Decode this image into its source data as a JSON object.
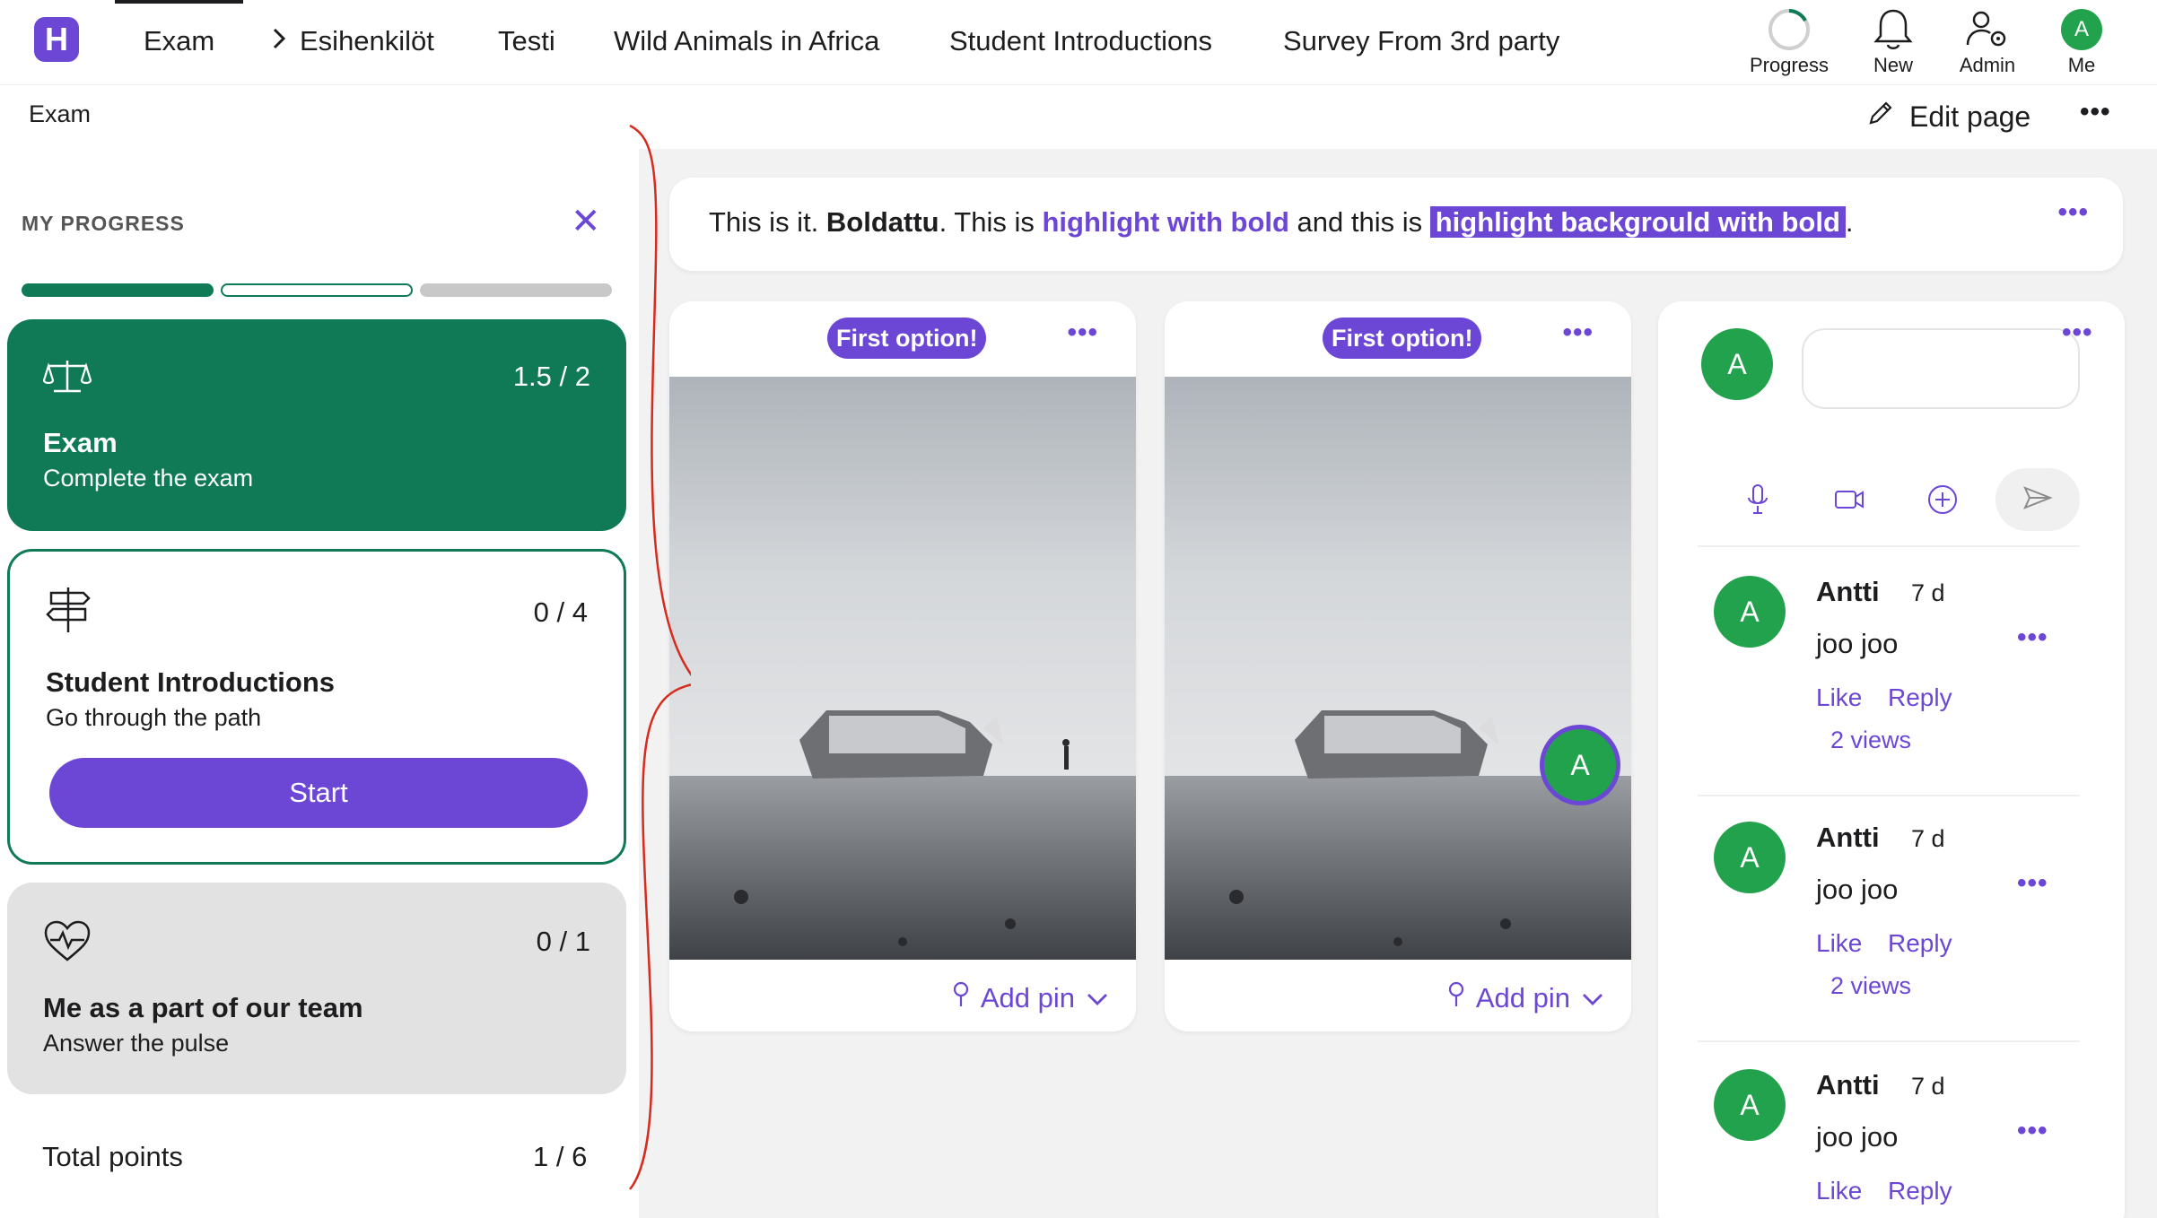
{
  "nav": {
    "logo": "H",
    "tabs": [
      {
        "label": "Exam",
        "active": true
      },
      {
        "label": "Esihenkilöt",
        "chevron": true
      },
      {
        "label": "Testi"
      },
      {
        "label": "Wild Animals in Africa"
      },
      {
        "label": "Student Introductions"
      },
      {
        "label": "Survey From 3rd party"
      }
    ],
    "right": [
      {
        "label": "Progress",
        "icon": "progress-ring-icon"
      },
      {
        "label": "New",
        "icon": "bell-icon"
      },
      {
        "label": "Admin",
        "icon": "user-gear-icon"
      },
      {
        "label": "Me",
        "icon": "avatar",
        "initial": "A"
      }
    ]
  },
  "breadcrumb": "Exam",
  "toolbar": {
    "edit_label": "Edit page"
  },
  "sidebar": {
    "heading": "MY PROGRESS",
    "cards": [
      {
        "title": "Exam",
        "subtitle": "Complete the exam",
        "score": "1.5 / 2",
        "icon": "scales-icon",
        "state": "completed"
      },
      {
        "title": "Student Introductions",
        "subtitle": "Go through the path",
        "score": "0 / 4",
        "icon": "signpost-icon",
        "state": "current",
        "button": "Start"
      },
      {
        "title": "Me as a part of our team",
        "subtitle": "Answer the pulse",
        "score": "0 / 1",
        "icon": "heart-pulse-icon",
        "state": "locked"
      }
    ],
    "total_label": "Total points",
    "total_value": "1 / 6"
  },
  "text_block": {
    "part1": "This is it. ",
    "bold": "Boldattu",
    "part2": ". This is ",
    "highlight_bold": "highlight with bold",
    "part3": " and this is ",
    "highlight_bg_bold": "highlight backgrould with bold",
    "part4": "."
  },
  "image_cards": [
    {
      "option_label": "First option!",
      "add_pin_label": "Add pin"
    },
    {
      "option_label": "First option!",
      "add_pin_label": "Add pin",
      "pin_initial": "A"
    }
  ],
  "comments": {
    "author_initial": "A",
    "items": [
      {
        "author": "Antti",
        "age": "7 d",
        "text": "joo joo",
        "like": "Like",
        "reply": "Reply",
        "views": "2 views"
      },
      {
        "author": "Antti",
        "age": "7 d",
        "text": "joo joo",
        "like": "Like",
        "reply": "Reply",
        "views": "2 views"
      },
      {
        "author": "Antti",
        "age": "7 d",
        "text": "joo joo",
        "like": "Like",
        "reply": "Reply"
      }
    ]
  },
  "colors": {
    "brand": "#6c47d6",
    "complete": "#0f7a55",
    "avatar": "#23a24d",
    "annotation": "#d62b1f"
  }
}
